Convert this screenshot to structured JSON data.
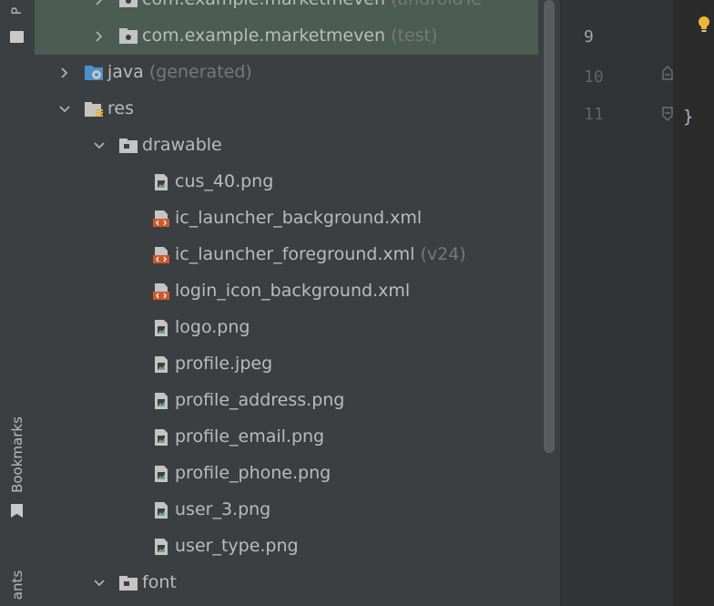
{
  "left_strip": {
    "top_label": "P",
    "bookmarks_label": "Bookmarks",
    "bottom_label": "ants"
  },
  "tree": {
    "rows": [
      {
        "label": "com.example.marketmeven",
        "suffix": "(androidTe",
        "icon": "package-folder-icon",
        "chevron": "right",
        "indent": 2,
        "selected": true,
        "partial": true
      },
      {
        "label": "com.example.marketmeven",
        "suffix": "(test)",
        "icon": "package-folder-icon",
        "chevron": "right",
        "indent": 2,
        "selected": true
      },
      {
        "label": "java",
        "suffix": "(generated)",
        "icon": "java-generated-folder-icon",
        "chevron": "right",
        "indent": 1
      },
      {
        "label": "res",
        "suffix": "",
        "icon": "resources-folder-icon",
        "chevron": "down",
        "indent": 1
      },
      {
        "label": "drawable",
        "suffix": "",
        "icon": "folder-icon",
        "chevron": "down",
        "indent": 2
      },
      {
        "label": "cus_40.png",
        "suffix": "",
        "icon": "image-file-icon",
        "chevron": "none",
        "indent": 3
      },
      {
        "label": "ic_launcher_background.xml",
        "suffix": "",
        "icon": "xml-file-icon",
        "chevron": "none",
        "indent": 3
      },
      {
        "label": "ic_launcher_foreground.xml",
        "suffix": "(v24)",
        "icon": "xml-file-icon",
        "chevron": "none",
        "indent": 3
      },
      {
        "label": "login_icon_background.xml",
        "suffix": "",
        "icon": "xml-file-icon",
        "chevron": "none",
        "indent": 3
      },
      {
        "label": "logo.png",
        "suffix": "",
        "icon": "image-file-icon",
        "chevron": "none",
        "indent": 3
      },
      {
        "label": "profile.jpeg",
        "suffix": "",
        "icon": "image-file-icon",
        "chevron": "none",
        "indent": 3
      },
      {
        "label": "profile_address.png",
        "suffix": "",
        "icon": "image-file-icon",
        "chevron": "none",
        "indent": 3
      },
      {
        "label": "profile_email.png",
        "suffix": "",
        "icon": "image-file-icon",
        "chevron": "none",
        "indent": 3
      },
      {
        "label": "profile_phone.png",
        "suffix": "",
        "icon": "image-file-icon",
        "chevron": "none",
        "indent": 3
      },
      {
        "label": "user_3.png",
        "suffix": "",
        "icon": "image-file-icon",
        "chevron": "none",
        "indent": 3
      },
      {
        "label": "user_type.png",
        "suffix": "",
        "icon": "image-file-icon",
        "chevron": "none",
        "indent": 3
      },
      {
        "label": "font",
        "suffix": "",
        "icon": "folder-icon",
        "chevron": "down",
        "indent": 2
      }
    ]
  },
  "gutter": {
    "lines": [
      "9",
      "10",
      "11"
    ],
    "code_last": "}"
  },
  "colors": {
    "panel_bg": "#3c3f41",
    "selected_bg": "#4b5d52",
    "editor_bg": "#2b2b2b",
    "gutter_bg": "#313335",
    "text": "#bbbbbb",
    "suffix": "#787878",
    "xml_accent": "#cc5a2e",
    "bulb": "#f0b533"
  }
}
